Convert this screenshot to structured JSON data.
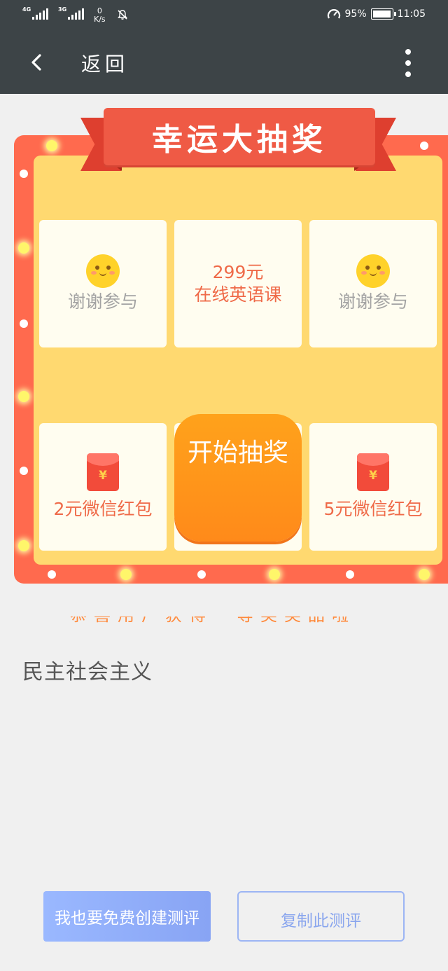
{
  "status_bar": {
    "signal1_tag": "4G",
    "signal2_tag": "3G",
    "net_speed_value": "0",
    "net_speed_unit": "K/s",
    "battery_percent": "95%",
    "time": "11:05"
  },
  "header": {
    "back_label": "返回"
  },
  "lottery": {
    "title": "幸运大抽奖",
    "prizes": [
      {
        "icon": "smiley-icon",
        "text": "谢谢参与"
      },
      {
        "line1": "299元",
        "line2": "在线英语课"
      },
      {
        "icon": "smiley-icon",
        "text": "谢谢参与"
      },
      {
        "icon": "red-envelope-icon",
        "text": "2元微信红包"
      },
      {
        "icon": "red-envelope-icon",
        "text": "5元微信红包"
      }
    ],
    "envelope_symbol": "¥",
    "start_label": "开始抽奖"
  },
  "marquee_text": "恭喜用户获得一等奖奖品啦",
  "answer_text": "民主社会主义",
  "buttons": {
    "create_label": "我也要免费创建测评",
    "copy_label": "复制此测评"
  },
  "colors": {
    "header_bg": "#3d4447",
    "frame_red": "#ff6a4e",
    "board_yellow": "#ffd970",
    "start_orange": "#ff9a1a",
    "primary_blue": "#8aa6ee"
  }
}
